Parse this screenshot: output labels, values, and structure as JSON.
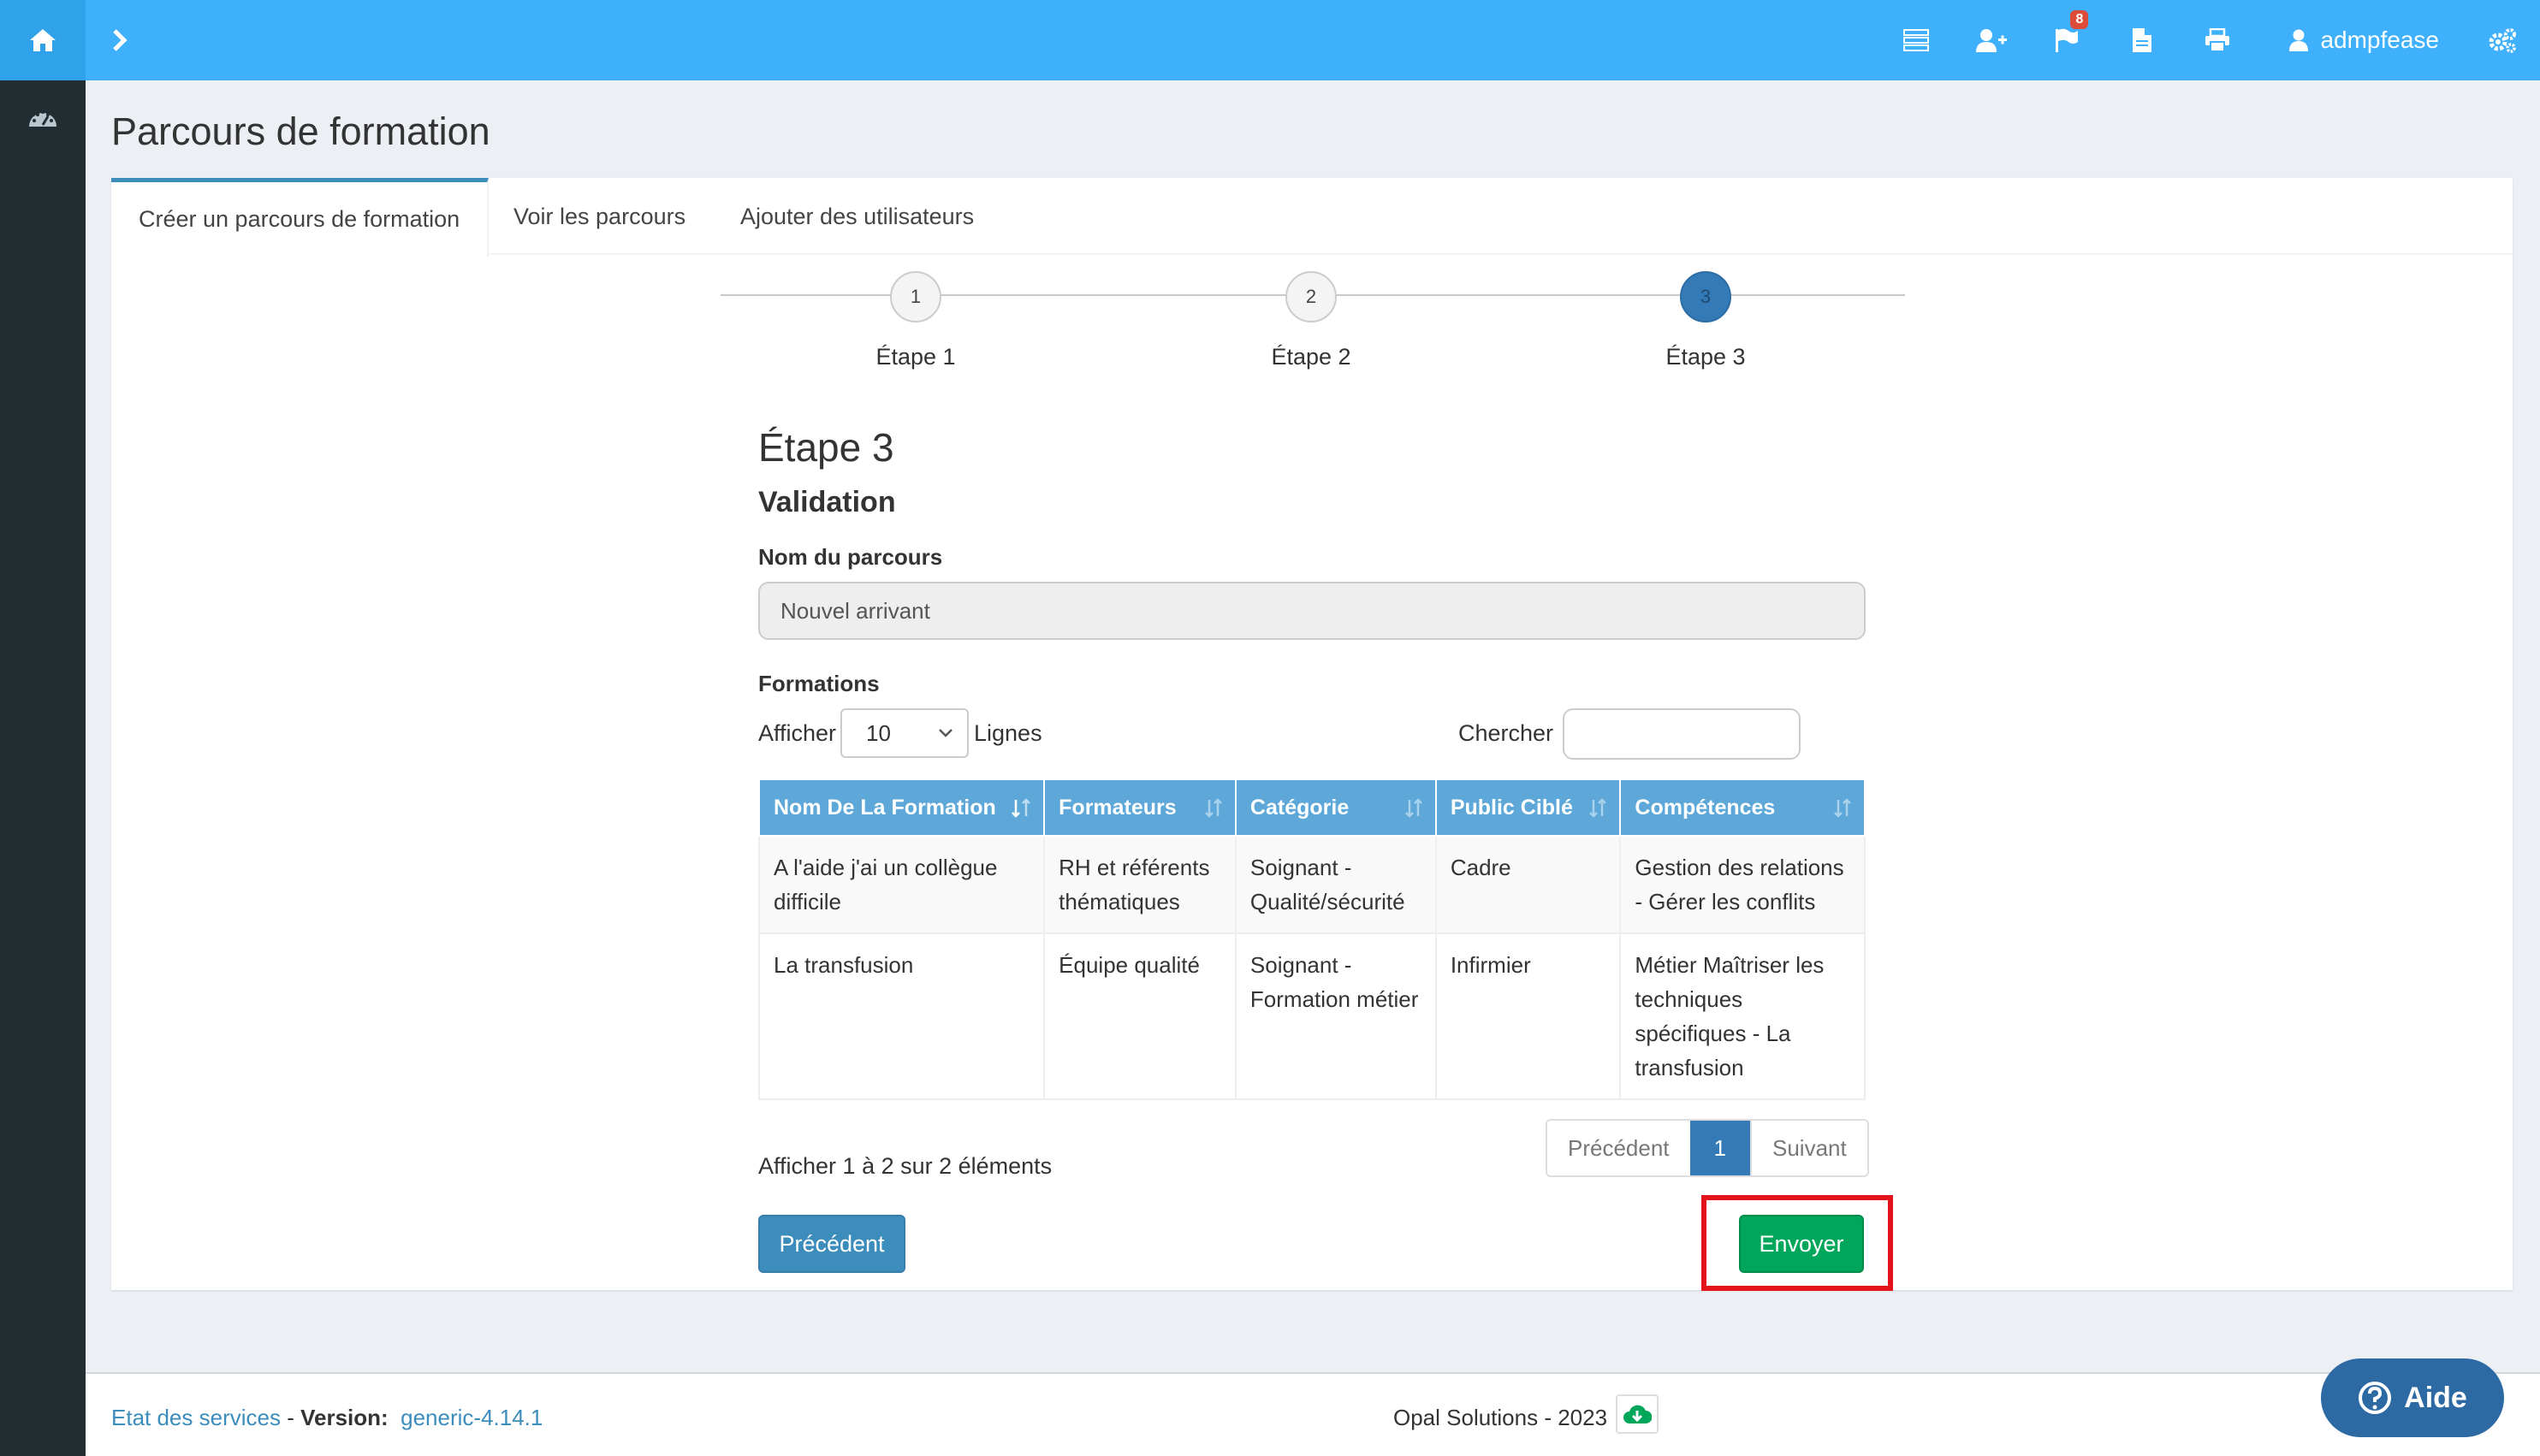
{
  "topbar": {
    "notifications_count": "8",
    "username": "admpfease",
    "icons": [
      "home-icon",
      "chevron-right-icon",
      "list-icon",
      "user-plus-icon",
      "flag-icon",
      "file-icon",
      "print-icon",
      "user-icon",
      "cogs-icon"
    ]
  },
  "sidebar": {
    "icons": [
      "dashboard-icon"
    ]
  },
  "page": {
    "title": "Parcours de formation"
  },
  "tabs": [
    {
      "label": "Créer un parcours de formation",
      "active": true
    },
    {
      "label": "Voir les parcours"
    },
    {
      "label": "Ajouter des utilisateurs"
    }
  ],
  "stepper": {
    "steps": [
      {
        "number": "1",
        "label": "Étape 1"
      },
      {
        "number": "2",
        "label": "Étape 2"
      },
      {
        "number": "3",
        "label": "Étape 3",
        "active": true
      }
    ]
  },
  "form": {
    "heading": "Étape 3",
    "subheading": "Validation",
    "name_label": "Nom du parcours",
    "name_value": "Nouvel arrivant",
    "formations_label": "Formations",
    "show_label": "Afficher",
    "page_size": "10",
    "rows_label": "Lignes",
    "search_label": "Chercher",
    "search_value": ""
  },
  "table": {
    "columns": [
      "Nom De La Formation",
      "Formateurs",
      "Catégorie",
      "Public Ciblé",
      "Compétences"
    ],
    "rows": [
      [
        "A l'aide j'ai un collègue difficile",
        "RH et référents thématiques",
        "Soignant - Qualité/sécurité",
        "Cadre",
        "Gestion des relations - Gérer les conflits"
      ],
      [
        "La transfusion",
        "Équipe qualité",
        "Soignant - Formation métier",
        "Infirmier",
        "Métier Maîtriser les techniques spécifiques - La transfusion"
      ]
    ]
  },
  "pagination": {
    "info": "Afficher 1 à 2 sur 2 éléments",
    "prev": "Précédent",
    "current": "1",
    "next": "Suivant"
  },
  "actions": {
    "prev_label": "Précédent",
    "send_label": "Envoyer"
  },
  "footer": {
    "status_link": "Etat des services",
    "version_label": "Version:",
    "version_value": "generic-4.14.1",
    "copyright": "Opal Solutions - 2023"
  },
  "help": {
    "label": "Aide"
  },
  "colors": {
    "topbar": "#3fb0fb",
    "sidebar": "#222d32",
    "primary": "#3c8dbc",
    "success": "#00a65a",
    "highlight": "#e4131b"
  }
}
